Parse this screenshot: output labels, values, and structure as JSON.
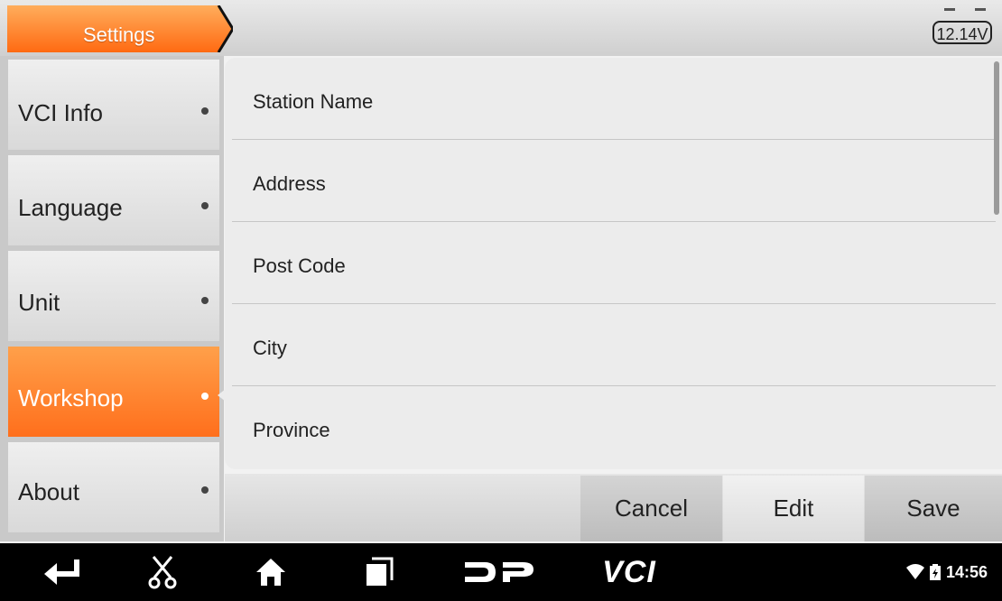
{
  "header": {
    "title": "Settings",
    "voltage": "12.14V"
  },
  "sidebar": {
    "items": [
      {
        "label": "VCI Info"
      },
      {
        "label": "Language"
      },
      {
        "label": "Unit"
      },
      {
        "label": "Workshop",
        "active": true
      },
      {
        "label": "About"
      }
    ]
  },
  "form": {
    "fields": [
      {
        "label": "Station Name",
        "value": ""
      },
      {
        "label": "Address",
        "value": ""
      },
      {
        "label": "Post Code",
        "value": ""
      },
      {
        "label": "City",
        "value": ""
      },
      {
        "label": "Province",
        "value": ""
      }
    ]
  },
  "actions": {
    "cancel": "Cancel",
    "edit": "Edit",
    "save": "Save"
  },
  "navbar": {
    "icons": [
      "back-icon",
      "scissors-icon",
      "home-icon",
      "recent-apps-icon",
      "dp-logo-icon",
      "vci-logo-icon"
    ],
    "logo_text": "VCI",
    "time": "14:56"
  },
  "colors": {
    "accent": "#ff7a1f",
    "accent_light": "#ffa04a"
  }
}
